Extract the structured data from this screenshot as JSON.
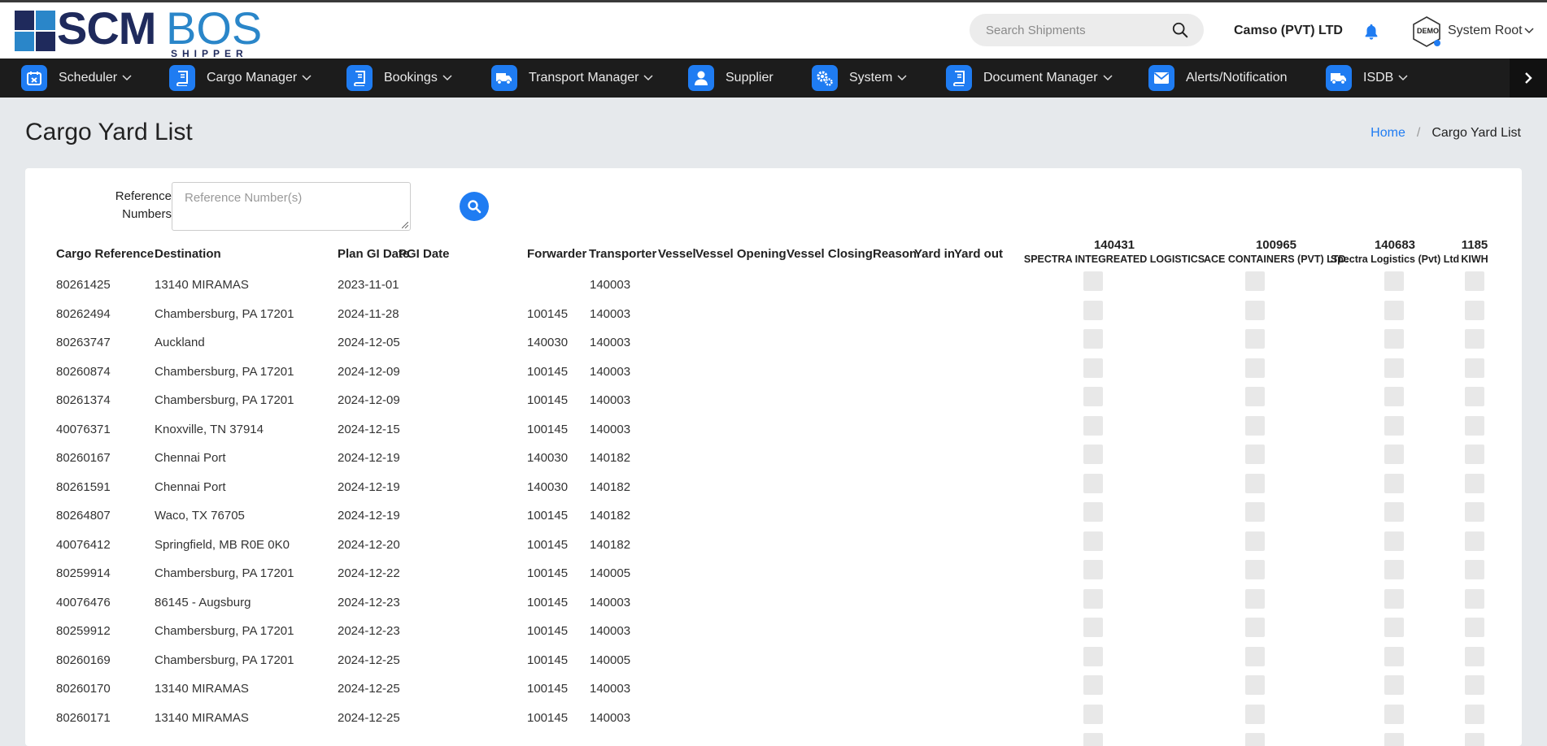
{
  "brand": {
    "name_part1": "SCM",
    "name_part2": "BOS",
    "tagline": "SHIPPER",
    "colors": {
      "dark": "#1f2a5c",
      "light": "#2a86c9",
      "accent": "#1f7cf2"
    }
  },
  "header": {
    "search_placeholder": "Search Shipments",
    "company": "Camso (PVT) LTD",
    "avatar_label": "DEMO",
    "user_name": "System Root"
  },
  "nav": {
    "items": [
      {
        "label": "Scheduler",
        "icon": "calendar-icon",
        "dropdown": true
      },
      {
        "label": "Cargo Manager",
        "icon": "book-icon",
        "dropdown": true
      },
      {
        "label": "Bookings",
        "icon": "book-icon",
        "dropdown": true
      },
      {
        "label": "Transport Manager",
        "icon": "truck-icon",
        "dropdown": true
      },
      {
        "label": "Supplier",
        "icon": "user-icon",
        "dropdown": false
      },
      {
        "label": "System",
        "icon": "gears-icon",
        "dropdown": true
      },
      {
        "label": "Document Manager",
        "icon": "book-icon",
        "dropdown": true
      },
      {
        "label": "Alerts/Notification",
        "icon": "envelope-icon",
        "dropdown": false
      },
      {
        "label": "ISDB",
        "icon": "truck-icon",
        "dropdown": true
      }
    ]
  },
  "page": {
    "title": "Cargo Yard List",
    "breadcrumb_home": "Home",
    "breadcrumb_sep": "/",
    "breadcrumb_current": "Cargo Yard List"
  },
  "filter": {
    "label_line1": "Reference",
    "label_line2": "Numbers",
    "placeholder": "Reference Number(s)"
  },
  "table": {
    "headers": {
      "cargo_ref": "Cargo Reference",
      "destination": "Destination",
      "plan_gi": "Plan GI Date",
      "pgi": "PGI Date",
      "forwarder": "Forwarder",
      "transporter": "Transporter",
      "vessel": "Vessel",
      "vessel_opening": "Vessel Opening",
      "vessel_closing": "Vessel Closing",
      "reason": "Reason",
      "yard_in": "Yard in",
      "yard_out": "Yard out"
    },
    "yards": [
      {
        "id": "140431",
        "name": "SPECTRA INTEGREATED LOGISTICS"
      },
      {
        "id": "100965",
        "name": "ACE CONTAINERS (PVT) LTD."
      },
      {
        "id": "140683",
        "name": "Spectra Logistics (Pvt) Ltd"
      },
      {
        "id": "1185",
        "name": "KIWH"
      }
    ],
    "rows": [
      {
        "ref": "80261425",
        "dest": "13140 MIRAMAS",
        "plan": "2023-11-01",
        "fwd": "",
        "trans": "140003"
      },
      {
        "ref": "80262494",
        "dest": "Chambersburg, PA 17201",
        "plan": "2024-11-28",
        "fwd": "100145",
        "trans": "140003"
      },
      {
        "ref": "80263747",
        "dest": "Auckland",
        "plan": "2024-12-05",
        "fwd": "140030",
        "trans": "140003"
      },
      {
        "ref": "80260874",
        "dest": "Chambersburg, PA 17201",
        "plan": "2024-12-09",
        "fwd": "100145",
        "trans": "140003"
      },
      {
        "ref": "80261374",
        "dest": "Chambersburg, PA 17201",
        "plan": "2024-12-09",
        "fwd": "100145",
        "trans": "140003"
      },
      {
        "ref": "40076371",
        "dest": "Knoxville, TN 37914",
        "plan": "2024-12-15",
        "fwd": "100145",
        "trans": "140003"
      },
      {
        "ref": "80260167",
        "dest": "Chennai Port",
        "plan": "2024-12-19",
        "fwd": "140030",
        "trans": "140182"
      },
      {
        "ref": "80261591",
        "dest": "Chennai Port",
        "plan": "2024-12-19",
        "fwd": "140030",
        "trans": "140182"
      },
      {
        "ref": "80264807",
        "dest": "Waco, TX 76705",
        "plan": "2024-12-19",
        "fwd": "100145",
        "trans": "140182"
      },
      {
        "ref": "40076412",
        "dest": "Springfield, MB R0E 0K0",
        "plan": "2024-12-20",
        "fwd": "100145",
        "trans": "140182"
      },
      {
        "ref": "80259914",
        "dest": "Chambersburg, PA 17201",
        "plan": "2024-12-22",
        "fwd": "100145",
        "trans": "140005"
      },
      {
        "ref": "40076476",
        "dest": "86145 - Augsburg",
        "plan": "2024-12-23",
        "fwd": "100145",
        "trans": "140003"
      },
      {
        "ref": "80259912",
        "dest": "Chambersburg, PA 17201",
        "plan": "2024-12-23",
        "fwd": "100145",
        "trans": "140003"
      },
      {
        "ref": "80260169",
        "dest": "Chambersburg, PA 17201",
        "plan": "2024-12-25",
        "fwd": "100145",
        "trans": "140005"
      },
      {
        "ref": "80260170",
        "dest": "13140 MIRAMAS",
        "plan": "2024-12-25",
        "fwd": "100145",
        "trans": "140003"
      },
      {
        "ref": "80260171",
        "dest": "13140 MIRAMAS",
        "plan": "2024-12-25",
        "fwd": "100145",
        "trans": "140003"
      }
    ]
  }
}
